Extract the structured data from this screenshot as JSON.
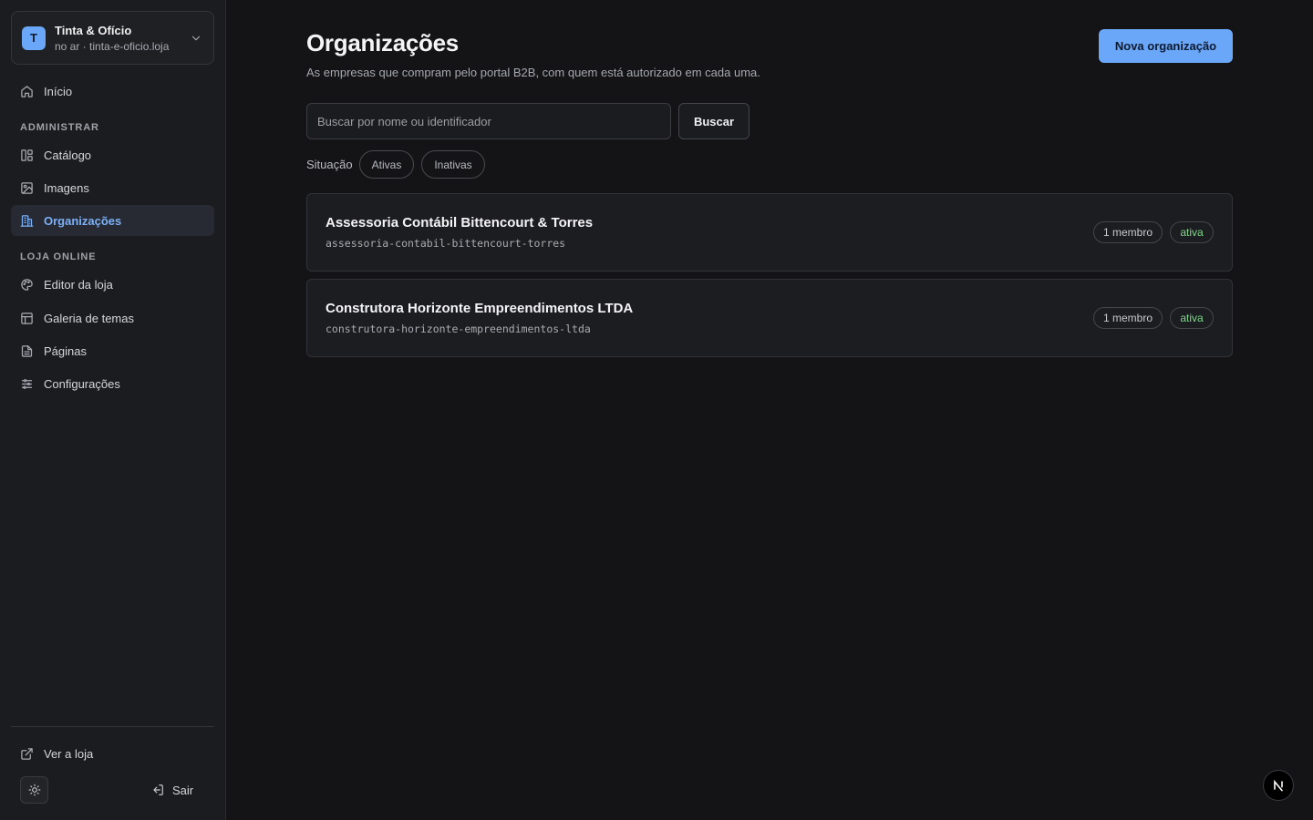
{
  "sidebar": {
    "store": {
      "initial": "T",
      "name": "Tinta & Ofício",
      "subtitle": "no ar · tinta-e-oficio.loja"
    },
    "home_label": "Início",
    "sections": [
      {
        "title": "ADMINISTRAR",
        "items": [
          {
            "label": "Catálogo",
            "icon": "catalog-icon"
          },
          {
            "label": "Imagens",
            "icon": "image-icon"
          },
          {
            "label": "Organizações",
            "icon": "building-icon",
            "active": true
          }
        ]
      },
      {
        "title": "LOJA ONLINE",
        "items": [
          {
            "label": "Editor da loja",
            "icon": "palette-icon"
          },
          {
            "label": "Galeria de temas",
            "icon": "layout-icon"
          },
          {
            "label": "Páginas",
            "icon": "file-icon"
          },
          {
            "label": "Configurações",
            "icon": "sliders-icon"
          }
        ]
      }
    ],
    "view_store_label": "Ver a loja",
    "logout_label": "Sair"
  },
  "main": {
    "title": "Organizações",
    "subtitle": "As empresas que compram pelo portal B2B, com quem está autorizado em cada uma.",
    "new_button_label": "Nova organização",
    "search": {
      "placeholder": "Buscar por nome ou identificador",
      "value": "",
      "button_label": "Buscar"
    },
    "filter": {
      "label": "Situação",
      "options": [
        "Ativas",
        "Inativas"
      ]
    },
    "organizations": [
      {
        "name": "Assessoria Contábil Bittencourt & Torres",
        "slug": "assessoria-contabil-bittencourt-torres",
        "members": "1 membro",
        "status": "ativa"
      },
      {
        "name": "Construtora Horizonte Empreendimentos LTDA",
        "slug": "construtora-horizonte-empreendimentos-ltda",
        "members": "1 membro",
        "status": "ativa"
      }
    ]
  },
  "colors": {
    "accent": "#6aa7f8",
    "active_nav_text": "#7cb1f7",
    "status_active": "#7fd68a",
    "background": "#141416",
    "sidebar": "#1b1c1f"
  },
  "dev_badge": {
    "letter": "N"
  }
}
